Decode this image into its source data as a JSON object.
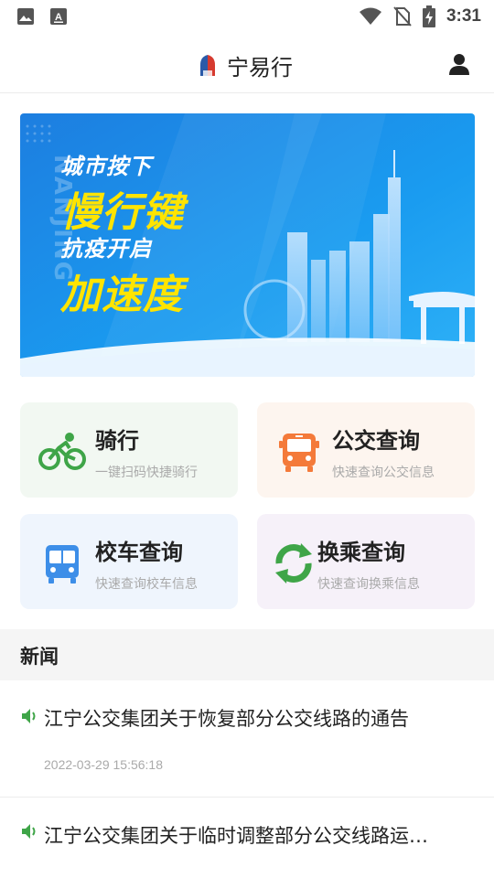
{
  "status_bar": {
    "time": "3:31",
    "icons": [
      "image-icon",
      "keyboard-icon",
      "wifi-icon",
      "no-sim-icon",
      "battery-charging-icon"
    ]
  },
  "header": {
    "title": "宁易行",
    "logo": "app-logo-icon",
    "user_icon": "user-icon"
  },
  "banner": {
    "line1": "城市按下",
    "line2": "慢行键",
    "line3": "抗疫开启",
    "line4": "加速度",
    "side_text": "NANJING"
  },
  "services": [
    {
      "title": "骑行",
      "subtitle": "一键扫码快捷骑行",
      "icon": "bicycle-icon",
      "bg": "#f2f8f2",
      "icon_color": "#3fa548"
    },
    {
      "title": "公交查询",
      "subtitle": "快速查询公交信息",
      "icon": "bus-icon",
      "bg": "#fdf5ef",
      "icon_color": "#f47a3a"
    },
    {
      "title": "校车查询",
      "subtitle": "快速查询校车信息",
      "icon": "school-bus-icon",
      "bg": "#eff5fd",
      "icon_color": "#3d8ee8"
    },
    {
      "title": "换乘查询",
      "subtitle": "快速查询换乘信息",
      "icon": "transfer-icon",
      "bg": "#f6f1f9",
      "icon_color": "#3fa548"
    }
  ],
  "news": {
    "section_title": "新闻",
    "items": [
      {
        "title": "江宁公交集团关于恢复部分公交线路的通告",
        "time": "2022-03-29 15:56:18"
      },
      {
        "title": "江宁公交集团关于临时调整部分公交线路运…",
        "time": ""
      }
    ]
  }
}
